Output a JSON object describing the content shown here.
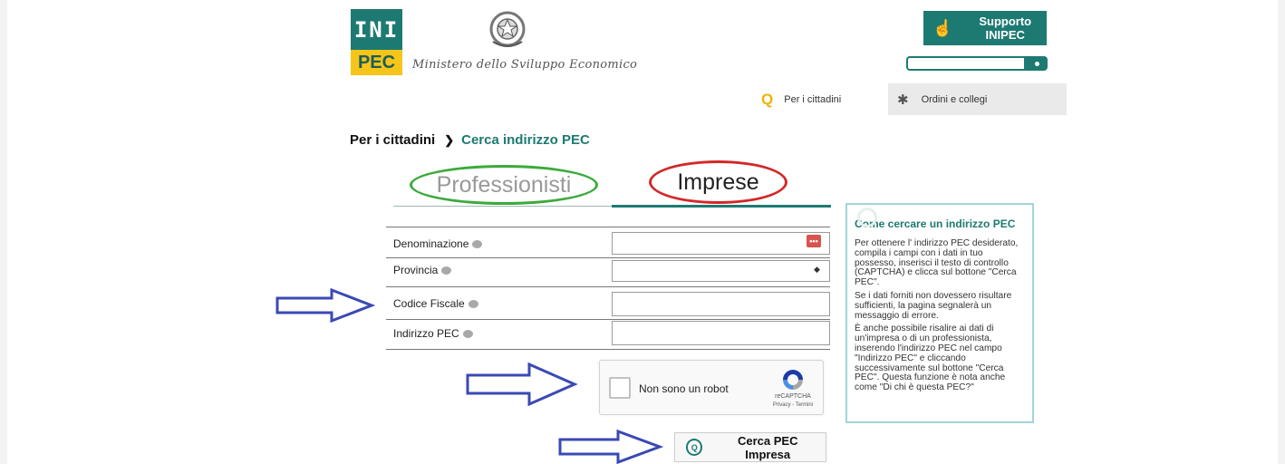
{
  "logo": {
    "top": "INI",
    "bottom": "PEC"
  },
  "ministry": "Ministero dello Sviluppo Economico",
  "support_label": "Supporto INIPEC",
  "header_search": {
    "value": "",
    "placeholder": ""
  },
  "nav": {
    "citizens": "Per i cittadini",
    "orders": "Ordini e collegi"
  },
  "breadcrumb": {
    "root": "Per i cittadini",
    "current": "Cerca indirizzo PEC"
  },
  "tabs": {
    "professionals": "Professionisti",
    "companies": "Imprese"
  },
  "form": {
    "fields": [
      {
        "label": "Denominazione",
        "value": ""
      },
      {
        "label": "Provincia",
        "value": ""
      },
      {
        "label": "Codice Fiscale",
        "value": ""
      },
      {
        "label": "Indirizzo PEC",
        "value": ""
      }
    ],
    "dots": "•••"
  },
  "recaptcha": {
    "label": "Non sono un robot",
    "brand": "reCAPTCHA",
    "links": "Privacy - Termini"
  },
  "search_button": "Cerca PEC Impresa",
  "help": {
    "title": "Come cercare un indirizzo PEC",
    "paragraphs": [
      "Per ottenere l' indirizzo PEC desiderato, compila i campi con i dati in tuo possesso, inserisci il testo di controllo (CAPTCHA) e clicca sul bottone \"Cerca PEC\".",
      "Se i dati forniti non dovessero risultare sufficienti, la pagina segnalerà un messaggio di errore.",
      "È anche possibile risalire ai dati di un'impresa o di un professionista, inserendo l'indirizzo PEC nel campo \"Indirizzo PEC\" e cliccando successivamente  sul bottone \"Cerca PEC\". Questa funzione è nota anche come \"Di chi è questa PEC?\""
    ]
  },
  "colors": {
    "brand": "#1d7a72",
    "yellow": "#f5c51a",
    "green_mark": "#3caa3c",
    "red_mark": "#d22828",
    "arrow": "#3a49b4"
  }
}
